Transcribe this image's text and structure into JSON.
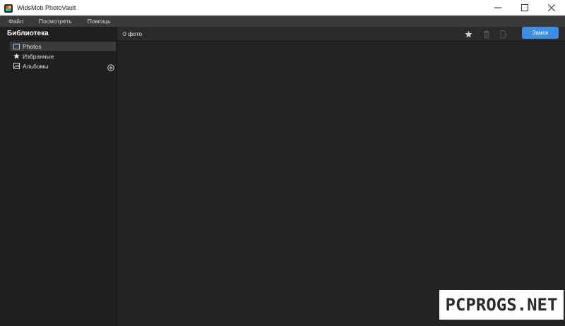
{
  "window": {
    "title": "WidsMob PhotoVault"
  },
  "menu": {
    "items": [
      "Файл",
      "Посмотреть",
      "Помощь"
    ]
  },
  "sidebar": {
    "title": "Библиотека",
    "items": [
      {
        "label": "Photos",
        "icon": "photo-frame-icon",
        "selected": true
      },
      {
        "label": "Избранные",
        "icon": "star-icon",
        "selected": false
      },
      {
        "label": "Альбомы",
        "icon": "album-icon",
        "selected": false
      }
    ]
  },
  "toolbar": {
    "photo_count": "0 фото",
    "lock_label": "Замок"
  },
  "watermark": {
    "text": "PCPROGS.NET"
  },
  "colors": {
    "accent": "#3a8ee6",
    "sidebar_bg": "#1f1f1f",
    "content_bg": "#232323",
    "menubar_bg": "#3a3a3a"
  }
}
